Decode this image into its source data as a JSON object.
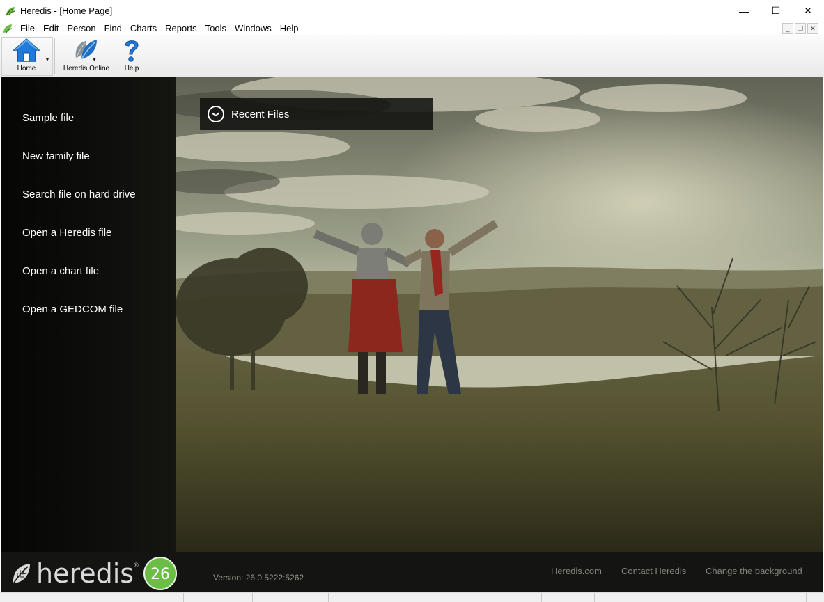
{
  "window": {
    "title": "Heredis - [Home Page]",
    "controls": {
      "minimize": "—",
      "maximize": "☐",
      "close": "✕"
    }
  },
  "menu": {
    "items": [
      "File",
      "Edit",
      "Person",
      "Find",
      "Charts",
      "Reports",
      "Tools",
      "Windows",
      "Help"
    ],
    "mdi": {
      "minimize": "_",
      "restore": "❐",
      "close": "✕"
    }
  },
  "toolbar": {
    "home_label": "Home",
    "online_label": "Heredis Online",
    "help_label": "Help"
  },
  "sidebar": {
    "items": [
      "Sample file",
      "New family file",
      "Search file on hard drive",
      "Open a Heredis file",
      "Open a chart file",
      "Open a GEDCOM file"
    ]
  },
  "recent": {
    "label": "Recent Files"
  },
  "footer": {
    "logo_text": "heredis",
    "logo_reg": "®",
    "badge_number": "26",
    "version": "Version: 26.0.5222:5262",
    "links": [
      "Heredis.com",
      "Contact Heredis",
      "Change the background"
    ]
  },
  "colors": {
    "accent_green": "#6bbd45",
    "home_blue": "#1f7ad8",
    "sidebar_bg": "#0c0c0a"
  }
}
